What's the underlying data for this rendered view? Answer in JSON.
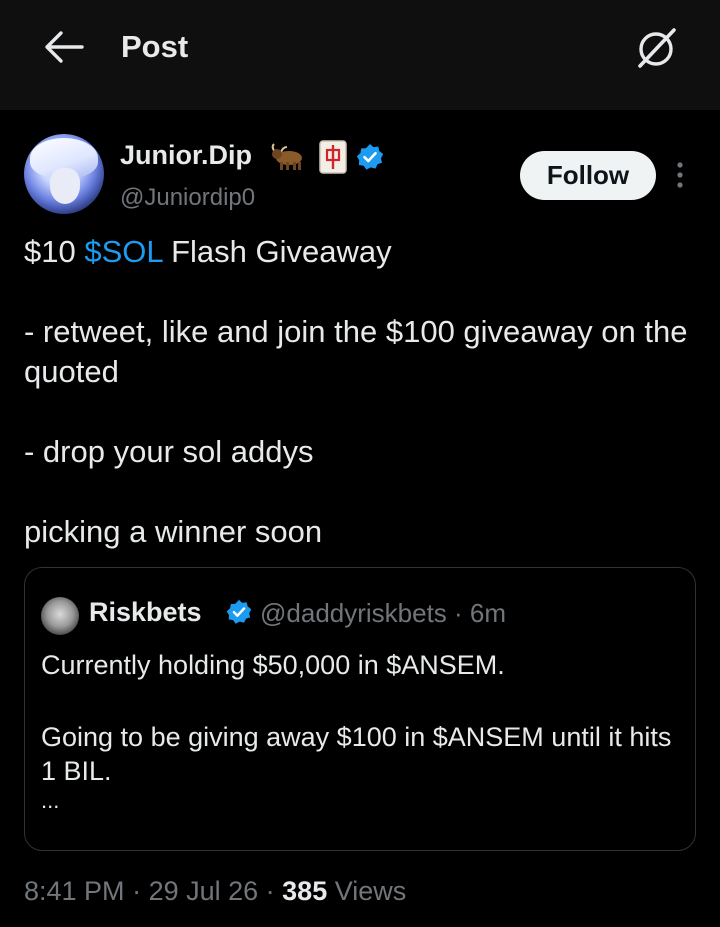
{
  "header": {
    "title": "Post",
    "back_icon": "arrow-left-icon",
    "grok_icon": "grok-icon"
  },
  "author": {
    "display_name": "Junior.Dip",
    "emojis": [
      "ox-emoji",
      "mahjong-red-dragon-emoji"
    ],
    "verified": true,
    "handle": "@Juniordip0",
    "follow_label": "Follow"
  },
  "post": {
    "line1_pre": "$10 ",
    "cashtag": "$SOL",
    "line1_post": " Flash Giveaway",
    "paragraph2": "- retweet, like and join the $100 giveaway on the quoted",
    "paragraph3": "- drop your sol addys",
    "paragraph4": "picking a winner soon"
  },
  "quote": {
    "display_name": "Riskbets",
    "verified": true,
    "meta": "@daddyriskbets · 6m",
    "paragraph1": "Currently holding $50,000 in $ANSEM.",
    "paragraph2": "Going to be giving away $100 in $ANSEM until it hits 1 BIL.",
    "ellipsis": "..."
  },
  "footer": {
    "time": "8:41 PM",
    "sep1": " · ",
    "date": "29 Jul 26",
    "sep2": " · ",
    "views_count": "385",
    "views_label": " Views"
  },
  "colors": {
    "accent": "#1d9bf0",
    "muted": "#71767b",
    "text": "#e7e9ea",
    "background": "#000000"
  }
}
